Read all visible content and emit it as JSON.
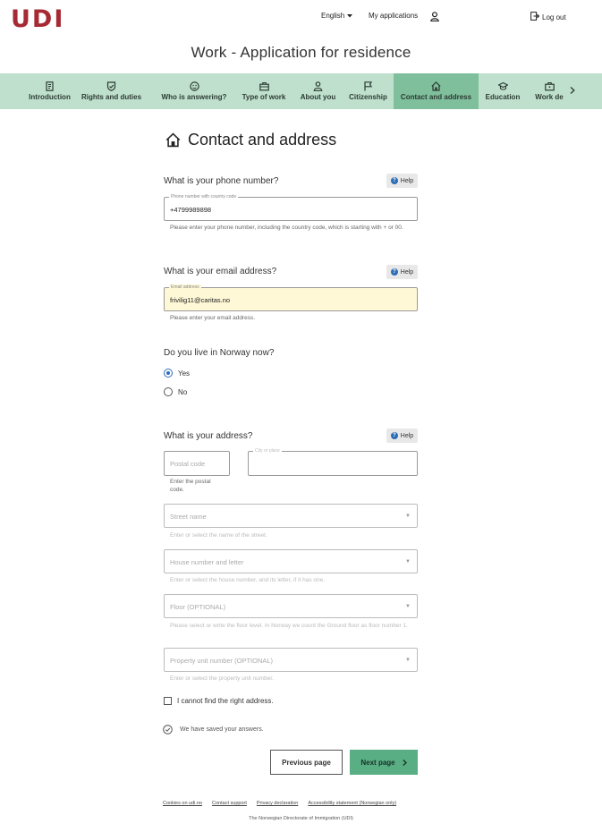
{
  "header": {
    "logo": "UDI",
    "language": "English",
    "my_applications": "My applications",
    "logout": "Log out"
  },
  "page_title": "Work - Application for residence",
  "steps": [
    {
      "label": "Introduction",
      "icon": "document-icon"
    },
    {
      "label": "Rights and duties",
      "icon": "shield-check-icon"
    },
    {
      "label": "Who is answering?",
      "icon": "face-icon"
    },
    {
      "label": "Type of work",
      "icon": "case-icon"
    },
    {
      "label": "About you",
      "icon": "person-icon"
    },
    {
      "label": "Citizenship",
      "icon": "flag-icon"
    },
    {
      "label": "Contact and address",
      "icon": "home-icon",
      "active": true
    },
    {
      "label": "Education",
      "icon": "graduation-cap-icon"
    },
    {
      "label": "Work de",
      "icon": "briefcase-icon"
    }
  ],
  "section": {
    "title": "Contact and address",
    "icon": "home-icon"
  },
  "phone": {
    "question": "What is your phone number?",
    "help": "Help",
    "field_label": "Phone number with country code",
    "value": "+4799989898",
    "hint": "Please enter your phone number, including the country code, which is starting with + or 00."
  },
  "email": {
    "question": "What is your email address?",
    "help": "Help",
    "field_label": "Email address",
    "value": "frivilig11@caritas.no",
    "hint": "Please enter your email address."
  },
  "live_in_norway": {
    "question": "Do you live in Norway now?",
    "options": [
      "Yes",
      "No"
    ],
    "selected": "Yes"
  },
  "address": {
    "question": "What is your address?",
    "help": "Help",
    "postal_code_placeholder": "Postal code",
    "postal_code_hint": "Enter the postal code.",
    "city_label": "City or place",
    "street_placeholder": "Street name",
    "street_hint": "Enter or select the name of the street.",
    "house_placeholder": "House number and letter",
    "house_hint": "Enter or select the house number, and its letter, if it has one.",
    "floor_placeholder": "Floor (OPTIONAL)",
    "floor_hint": "Please select or write the floor level. In Norway we count the Ground floor as floor number 1.",
    "unit_placeholder": "Property unit number (OPTIONAL)",
    "unit_hint": "Enter or select the property unit number.",
    "cannot_find": "I cannot find the right address."
  },
  "saved_text": "We have saved your answers.",
  "buttons": {
    "previous": "Previous page",
    "next": "Next page"
  },
  "footer": {
    "links": [
      "Cookies on udi.no",
      "Contact support",
      "Privacy declaration",
      "Accessibility statement (Norwegian only)"
    ],
    "org": "The Norwegian Directorate of Immigration (UDI)"
  },
  "colors": {
    "brand": "#a52a33",
    "steps_bg": "#bfe0cd",
    "step_active": "#7fbf9c",
    "next_button": "#5aae84",
    "email_field_bg": "#fff8d6",
    "radio_selected": "#2d6db5"
  }
}
